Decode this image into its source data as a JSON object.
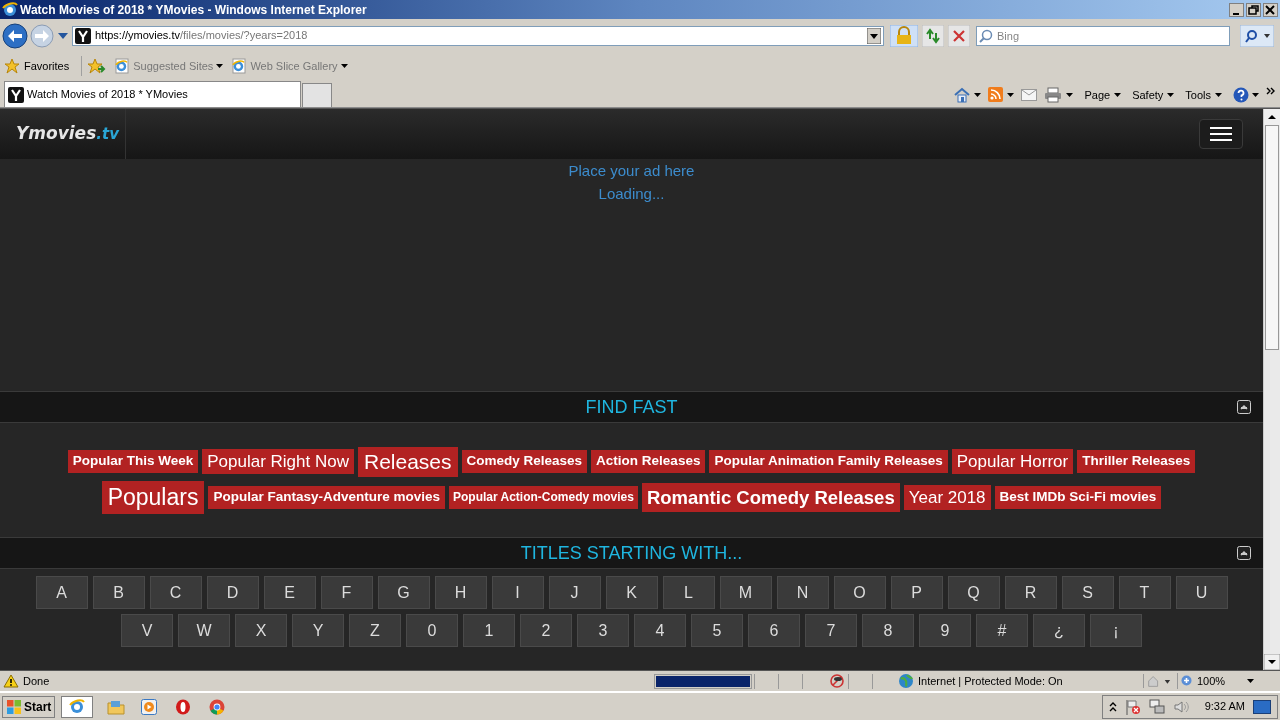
{
  "window": {
    "title": "Watch Movies of 2018 * YMovies - Windows Internet Explorer"
  },
  "address_bar": {
    "url_host": "https://ymovies.tv",
    "url_path": "/files/movies/?years=2018"
  },
  "search": {
    "placeholder": "Bing"
  },
  "favorites_bar": {
    "favorites": "Favorites",
    "links": [
      "Suggested Sites",
      "Web Slice Gallery"
    ]
  },
  "tabs": [
    {
      "label": "Watch Movies of 2018 * YMovies",
      "selected": true
    }
  ],
  "command_bar": [
    "Page",
    "Safety",
    "Tools"
  ],
  "site": {
    "logo_main": "Ymovies",
    "logo_tld": ".tv",
    "ad_text": "Place your ad here",
    "loading": "Loading..."
  },
  "find_fast": {
    "title": "FIND FAST",
    "tags": [
      {
        "label": "Popular This Week",
        "kind": "small"
      },
      {
        "label": "Popular Right Now",
        "kind": "medium"
      },
      {
        "label": "Releases",
        "kind": "large"
      },
      {
        "label": "Comedy Releases",
        "kind": "small"
      },
      {
        "label": "Action Releases",
        "kind": "small"
      },
      {
        "label": "Popular Animation Family Releases",
        "kind": "small"
      },
      {
        "label": "Popular Horror",
        "kind": "medium"
      },
      {
        "label": "Thriller Releases",
        "kind": "small"
      },
      {
        "label": "Populars",
        "kind": "huge"
      },
      {
        "label": "Popular Fantasy-Adventure movies",
        "kind": "small"
      },
      {
        "label": "Popular Action-Comedy movies",
        "kind": "tiny"
      },
      {
        "label": "Romantic Comedy Releases",
        "kind": "strong"
      },
      {
        "label": "Year 2018",
        "kind": "medium"
      },
      {
        "label": "Best IMDb Sci-Fi movies",
        "kind": "small"
      }
    ]
  },
  "titles_starting_with": {
    "title": "TITLES STARTING WITH...",
    "rows": [
      [
        "A",
        "B",
        "C",
        "D",
        "E",
        "F",
        "G",
        "H",
        "I",
        "J",
        "K",
        "L",
        "M",
        "N",
        "O",
        "P",
        "Q",
        "R",
        "S",
        "T",
        "U"
      ],
      [
        "V",
        "W",
        "X",
        "Y",
        "Z",
        "0",
        "1",
        "2",
        "3",
        "4",
        "5",
        "6",
        "7",
        "8",
        "9",
        "#",
        "¿",
        "¡"
      ]
    ]
  },
  "status_bar": {
    "text": "Done",
    "progress": {
      "level": 1
    },
    "zone": "Internet | Protected Mode: On",
    "zoom": "100%"
  },
  "taskbar": {
    "start": "Start",
    "time": "9:32 AM"
  }
}
